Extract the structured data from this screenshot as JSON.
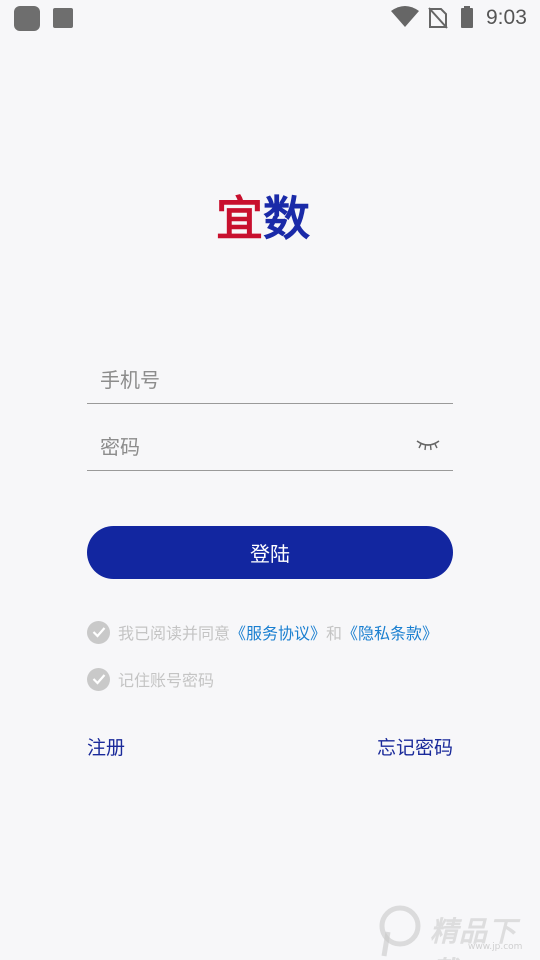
{
  "status_bar": {
    "time": "9:03"
  },
  "logo": {
    "char1": "宜",
    "char2": "数",
    "color1": "#c8102e",
    "color2": "#1a2aa8"
  },
  "form": {
    "phone_placeholder": "手机号",
    "password_placeholder": "密码",
    "login_label": "登陆"
  },
  "agreement": {
    "prefix": "我已阅读并同意",
    "service_link": "《服务协议》",
    "and": "和",
    "privacy_link": "《隐私条款》"
  },
  "remember": {
    "label": "记住账号密码"
  },
  "links": {
    "register": "注册",
    "forgot_password": "忘记密码"
  },
  "watermark": {
    "text": "精品下载",
    "sub": "www.jp.com"
  },
  "colors": {
    "primary": "#1226a0",
    "link": "#1a7fd0",
    "background": "#f7f7f9"
  }
}
